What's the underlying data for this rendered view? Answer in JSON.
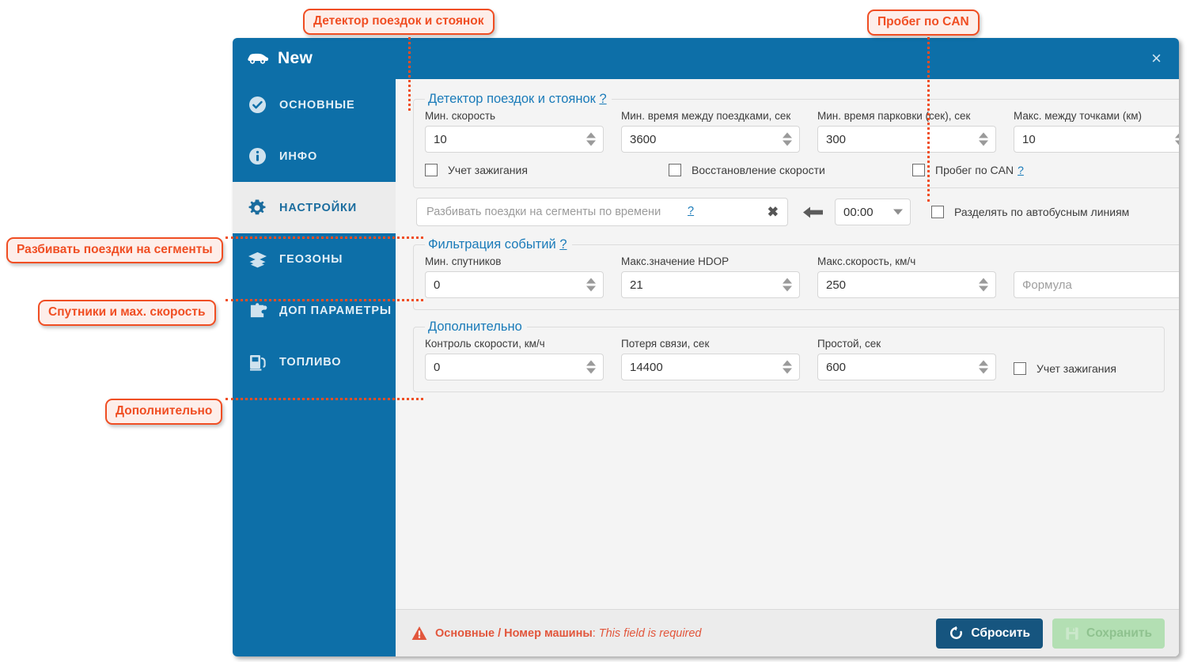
{
  "window": {
    "title": "New",
    "close_label": "×"
  },
  "sidebar": {
    "items": [
      {
        "label": "ОСНОВНЫЕ",
        "icon": "check-circle-icon",
        "active": false
      },
      {
        "label": "ИНФО",
        "icon": "info-circle-icon",
        "active": false
      },
      {
        "label": "НАСТРОЙКИ",
        "icon": "gear-icon",
        "active": true
      },
      {
        "label": "ГЕОЗОНЫ",
        "icon": "layers-icon",
        "active": false
      },
      {
        "label": "ДОП ПАРАМЕТРЫ",
        "icon": "puzzle-icon",
        "active": false
      },
      {
        "label": "ТОПЛИВО",
        "icon": "fuel-pump-icon",
        "active": false
      }
    ]
  },
  "sections": {
    "trip_detector": {
      "legend": "Детектор поездок и стоянок",
      "legend_help": "?",
      "fields": [
        {
          "label": "Мин. скорость",
          "value": "10"
        },
        {
          "label": "Мин. время между поездками, сек",
          "value": "3600"
        },
        {
          "label": "Мин. время парковки (сек), сек",
          "value": "300"
        },
        {
          "label": "Макс. между точками (км)",
          "value": "10"
        }
      ],
      "checkboxes": [
        {
          "label": "Учет зажигания",
          "checked": false,
          "help": ""
        },
        {
          "label": "Восстановление скорости",
          "checked": false,
          "help": ""
        },
        {
          "label": "Пробег по CAN",
          "checked": false,
          "help": "?"
        }
      ]
    },
    "segments_row": {
      "input_placeholder": "Разбивать поездки на сегменты по времени",
      "input_value": "",
      "input_help": "?",
      "clear_label": "✖",
      "arrow_icon": "arrow-left-icon",
      "time_value": "00:00",
      "checkbox": {
        "label": "Разделять по автобусным линиям",
        "checked": false
      }
    },
    "event_filter": {
      "legend": "Фильтрация событий",
      "legend_help": "?",
      "fields": [
        {
          "label": "Мин. спутников",
          "value": "0",
          "spinner": true
        },
        {
          "label": "Макс.значение HDOP",
          "value": "21",
          "spinner": true
        },
        {
          "label": "Макс.скорость, км/ч",
          "value": "250",
          "spinner": true
        },
        {
          "label": "",
          "value": "",
          "placeholder": "Формула",
          "spinner": false
        }
      ]
    },
    "additional": {
      "legend": "Дополнительно",
      "legend_help": "",
      "fields": [
        {
          "label": "Контроль скорости, км/ч",
          "value": "0"
        },
        {
          "label": "Потеря связи, сек",
          "value": "14400"
        },
        {
          "label": "Простой, сек",
          "value": "600"
        }
      ],
      "checkbox": {
        "label": "Учет зажигания",
        "checked": false
      }
    }
  },
  "footer": {
    "error_icon": "warning-triangle-icon",
    "error_path": "Основные / Номер машины",
    "error_sep": ":",
    "error_message": "This field is required",
    "reset_label": "Сбросить",
    "save_label": "Сохранить"
  },
  "annotations": [
    {
      "id": "a1",
      "text": "Детектор поездок и стоянок"
    },
    {
      "id": "a2",
      "text": "Пробег по CAN"
    },
    {
      "id": "a3",
      "text": "Разбивать поездки на сегменты"
    },
    {
      "id": "a4",
      "text": "Спутники и  мах.  скорость"
    },
    {
      "id": "a5",
      "text": "Дополнительно"
    }
  ],
  "colors": {
    "brand_blue": "#0d6fa8",
    "legend_blue": "#1a7bb9",
    "annotation_orange": "#f04e23",
    "error_red": "#e2563c",
    "reset_navy": "#16557f",
    "save_green": "#b3dfb3"
  }
}
